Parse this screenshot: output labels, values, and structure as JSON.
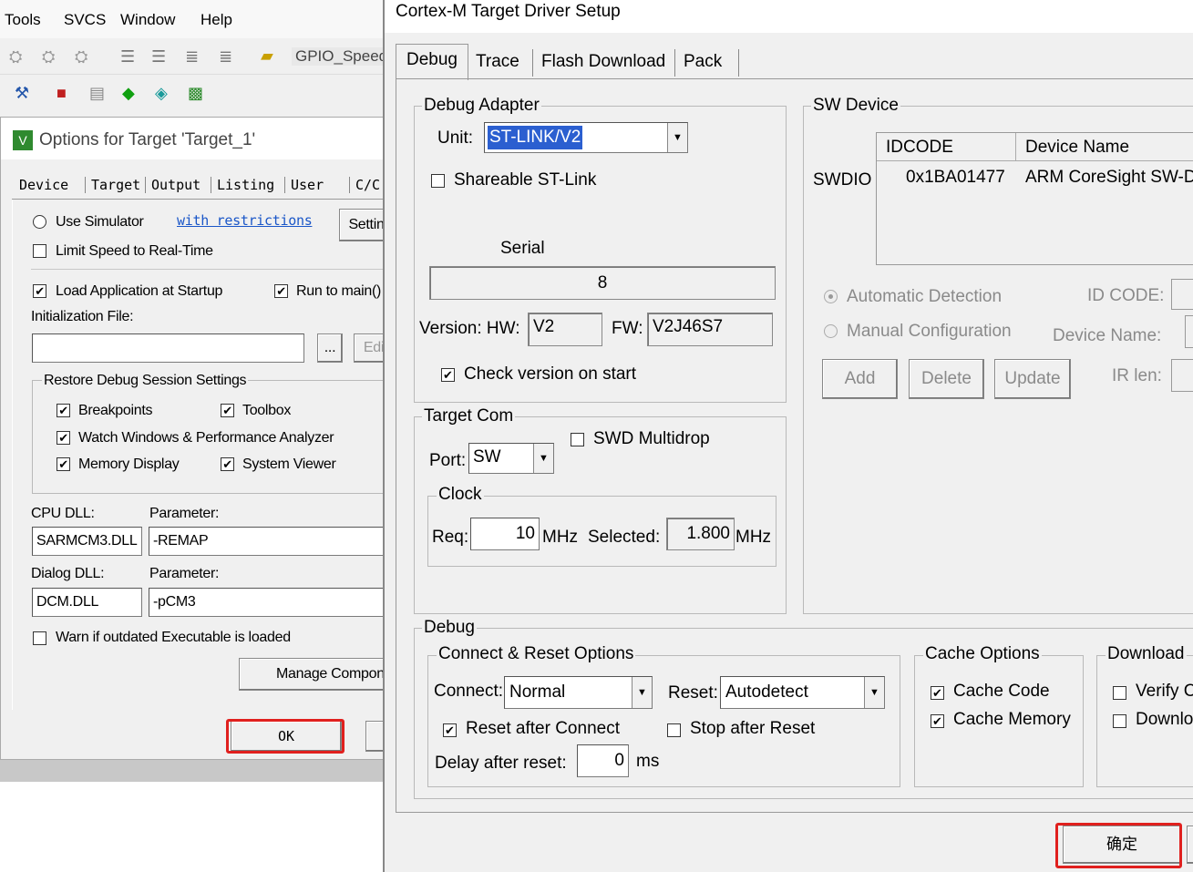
{
  "menubar": {
    "items": [
      "Tools",
      "SVCS",
      "Window",
      "Help"
    ]
  },
  "toolbar": {
    "combo_value": "GPIO_Speed"
  },
  "options_dialog": {
    "title": "Options for Target 'Target_1'",
    "tabs": [
      "Device",
      "Target",
      "Output",
      "Listing",
      "User",
      "C/C"
    ],
    "use_simulator": "Use Simulator",
    "with_restrictions": "with restrictions",
    "settings_btn": "Settin",
    "limit_speed": "Limit Speed to Real-Time",
    "load_app": "Load Application at Startup",
    "run_to_main": "Run to main()",
    "init_file": "Initialization File:",
    "browse_btn": "...",
    "edit_btn": "Edi",
    "restore_group": "Restore Debug Session Settings",
    "breakpoints": "Breakpoints",
    "toolbox": "Toolbox",
    "watch_windows": "Watch Windows & Performance Analyzer",
    "memory_display": "Memory Display",
    "system_viewer": "System Viewer",
    "cpu_dll_label": "CPU DLL:",
    "param_label": "Parameter:",
    "cpu_dll": "SARMCM3.DLL",
    "cpu_param": "-REMAP",
    "dialog_dll_label": "Dialog DLL:",
    "dialog_param_label": "Parameter:",
    "dialog_dll": "DCM.DLL",
    "dialog_param": "-pCM3",
    "warn": "Warn if outdated Executable is loaded",
    "manage_btn": "Manage Compon",
    "ok_btn": "OK"
  },
  "driver_dialog": {
    "title": "Cortex-M Target Driver Setup",
    "tabs": [
      "Debug",
      "Trace",
      "Flash Download",
      "Pack"
    ],
    "debug_adapter": {
      "group": "Debug Adapter",
      "unit_label": "Unit:",
      "unit": "ST-LINK/V2",
      "shareable": "Shareable ST-Link",
      "serial_label": "Serial",
      "serial": "8",
      "version_label": "Version: HW:",
      "hw": "V2",
      "fw_label": "FW:",
      "fw": "V2J46S7",
      "check_version": "Check version on start"
    },
    "target_com": {
      "group": "Target Com",
      "port_label": "Port:",
      "port": "SW",
      "swd_multidrop": "SWD Multidrop",
      "clock_group": "Clock",
      "req_label": "Req:",
      "req": "10",
      "mhz1": "MHz",
      "selected_label": "Selected:",
      "selected": "1.800",
      "mhz2": "MHz"
    },
    "sw_device": {
      "group": "SW Device",
      "col_idcode": "IDCODE",
      "col_device": "Device Name",
      "row_label": "SWDIO",
      "idcode": "0x1BA01477",
      "device": "ARM CoreSight SW-D",
      "auto_detect": "Automatic Detection",
      "manual_config": "Manual Configuration",
      "id_code_label": "ID CODE:",
      "device_name_label": "Device Name:",
      "ir_len_label": "IR len:",
      "add_btn": "Add",
      "delete_btn": "Delete",
      "update_btn": "Update"
    },
    "debug": {
      "group": "Debug",
      "connect_group": "Connect & Reset Options",
      "connect_label": "Connect:",
      "connect": "Normal",
      "reset_label": "Reset:",
      "reset": "Autodetect",
      "reset_after_connect": "Reset after Connect",
      "stop_after_reset": "Stop after Reset",
      "delay_label": "Delay after reset:",
      "delay": "0",
      "delay_unit": "ms",
      "cache_group": "Cache Options",
      "cache_code": "Cache Code",
      "cache_memory": "Cache Memory",
      "download_group": "Download",
      "verify": "Verify C",
      "download": "Downlo"
    },
    "ok_btn": "确定"
  }
}
